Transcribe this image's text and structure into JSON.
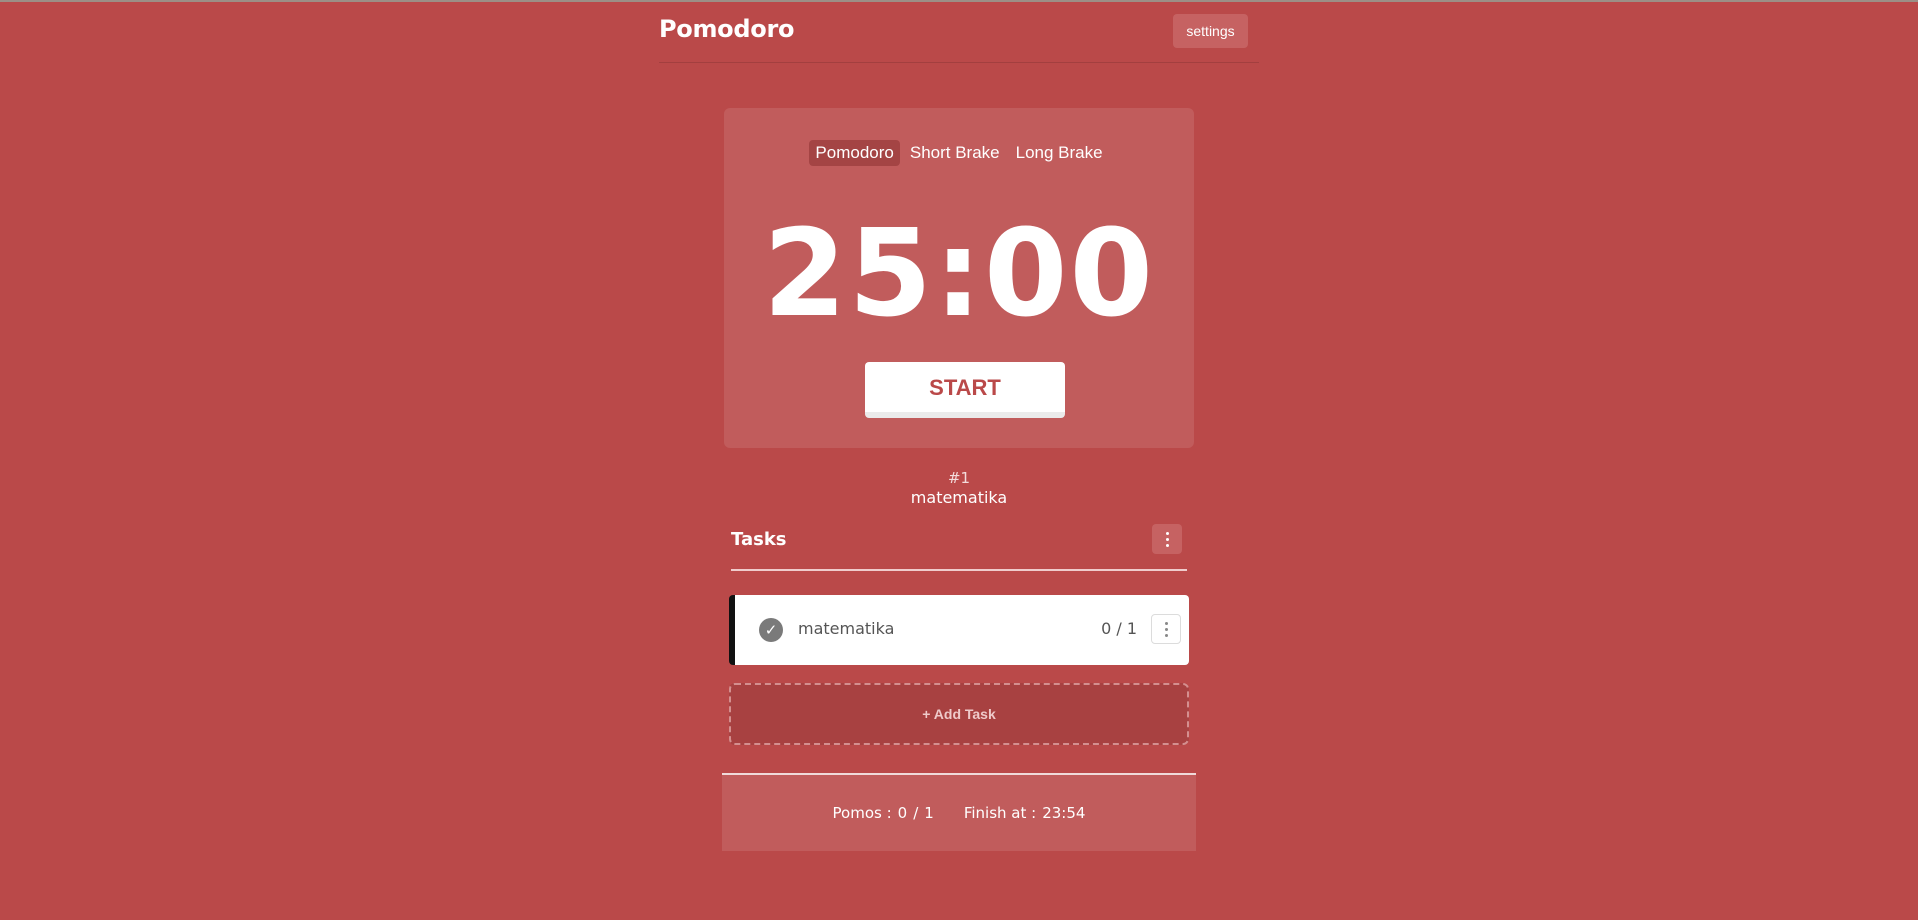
{
  "header": {
    "brand": "Pomodoro",
    "settings_label": "settings"
  },
  "timer": {
    "modes": [
      {
        "label": "Pomodoro",
        "active": true
      },
      {
        "label": "Short Brake",
        "active": false
      },
      {
        "label": "Long Brake",
        "active": false
      }
    ],
    "time": "25:00",
    "start_label": "START"
  },
  "current": {
    "number": "#1",
    "task": "matematika"
  },
  "tasks": {
    "title": "Tasks",
    "menu_icon": "kebab-icon",
    "items": [
      {
        "name": "matematika",
        "count": "0 / 1",
        "check_icon": "check-icon"
      }
    ],
    "add_label": "+ Add Task"
  },
  "footer": {
    "pomos_label": "Pomos :",
    "pomos_done": "0",
    "separator": "/",
    "pomos_total": "1",
    "finish_label": "Finish at :",
    "finish_time": "23:54"
  },
  "colors": {
    "background": "#ba4949",
    "card": "#c15c5c",
    "accent_text": "#ba4949"
  }
}
